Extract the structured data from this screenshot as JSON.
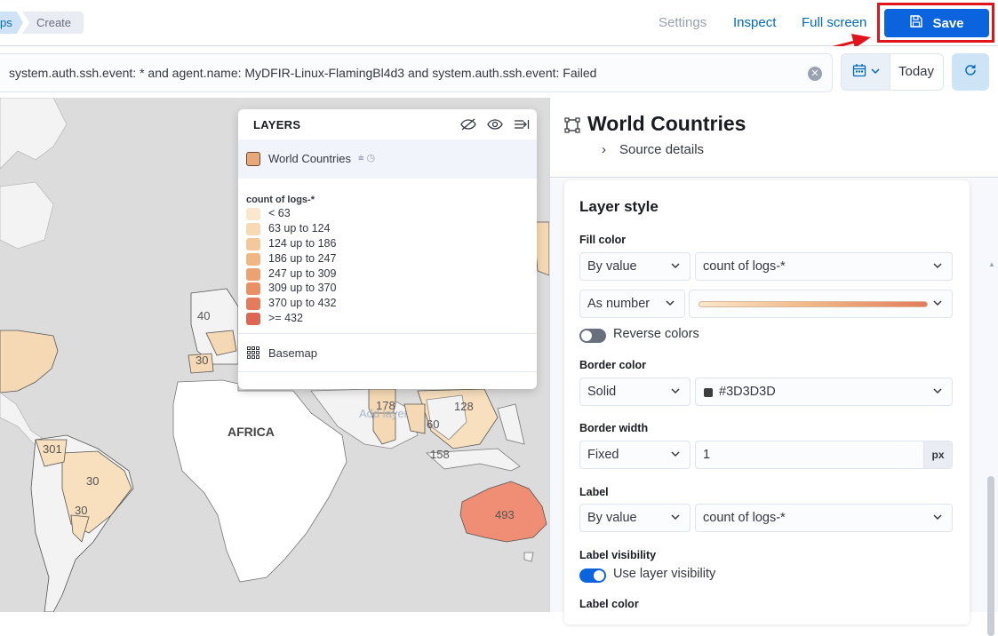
{
  "breadcrumbs": {
    "first": "ps",
    "second": "Create"
  },
  "top_nav": {
    "settings": "Settings",
    "inspect": "Inspect",
    "full_screen": "Full screen",
    "save": "Save"
  },
  "query": {
    "text": "system.auth.ssh.event: * and agent.name: MyDFIR-Linux-FlamingBl4d3 and system.auth.ssh.event: Failed",
    "date_label": "Today"
  },
  "map": {
    "continent_label": "AFRICA",
    "add_layer_hint": "Add layer",
    "region_values": [
      "40",
      "30",
      "301",
      "30",
      "30",
      "178",
      "128",
      "60",
      "158",
      "493"
    ]
  },
  "layers_panel": {
    "title": "LAYERS",
    "layer_name": "World Countries",
    "legend_title": "count of logs-*",
    "legend": [
      {
        "label": "< 63",
        "color": "#fbe7cd"
      },
      {
        "label": "63 up to 124",
        "color": "#f8d9b4"
      },
      {
        "label": "124 up to 186",
        "color": "#f5c89b"
      },
      {
        "label": "186 up to 247",
        "color": "#f1b684"
      },
      {
        "label": "247 up to 309",
        "color": "#eda371"
      },
      {
        "label": "309 up to 370",
        "color": "#e99065"
      },
      {
        "label": "370 up to 432",
        "color": "#e47c5c"
      },
      {
        "label": ">= 432",
        "color": "#de6655"
      }
    ],
    "basemap": "Basemap"
  },
  "right_panel": {
    "title": "World Countries",
    "source_details": "Source details",
    "layer_style": "Layer style",
    "fill_color_label": "Fill color",
    "fill_by": "By value",
    "fill_field": "count of logs-*",
    "fill_as": "As number",
    "reverse_colors": "Reverse colors",
    "border_color_label": "Border color",
    "border_type": "Solid",
    "border_color": "#3D3D3D",
    "border_width_label": "Border width",
    "border_width_mode": "Fixed",
    "border_width_value": "1",
    "border_width_unit": "px",
    "label_label": "Label",
    "label_by": "By value",
    "label_field": "count of logs-*",
    "label_visibility_label": "Label visibility",
    "use_layer_visibility": "Use layer visibility",
    "label_color_label": "Label color"
  },
  "colors": {
    "accent": "#0b64dd",
    "highlight": "#e0141a",
    "link": "#006bb8"
  }
}
